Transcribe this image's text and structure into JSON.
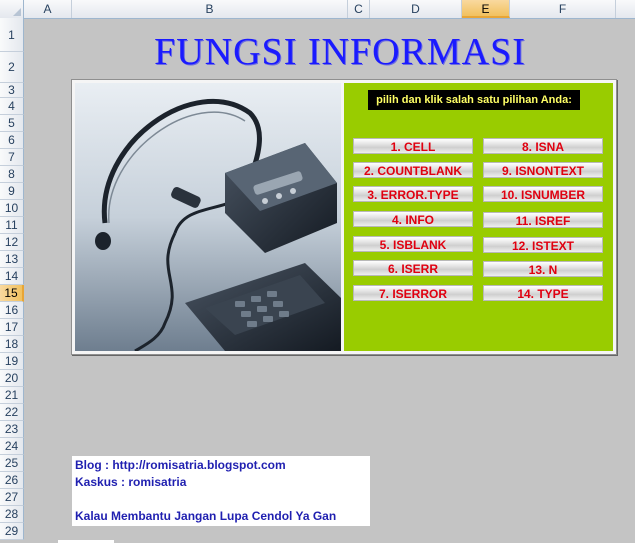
{
  "columns": [
    "A",
    "B",
    "C",
    "D",
    "E",
    "F"
  ],
  "selected_column": "E",
  "rows": [
    "1",
    "2",
    "3",
    "4",
    "5",
    "6",
    "7",
    "8",
    "9",
    "10",
    "11",
    "12",
    "13",
    "14",
    "15",
    "16",
    "17",
    "18",
    "19",
    "20",
    "21",
    "22",
    "23",
    "24",
    "25",
    "26",
    "27",
    "28",
    "29"
  ],
  "selected_row": "15",
  "title": "FUNGSI INFORMASI",
  "panel": {
    "hint": "pilih dan klik salah satu pilihan Anda:",
    "buttons_left": [
      "1. CELL",
      "2. COUNTBLANK",
      "3. ERROR.TYPE",
      "4. INFO",
      "5. ISBLANK",
      "6. ISERR",
      "7. ISERROR"
    ],
    "buttons_right": [
      "8. ISNA",
      "9. ISNONTEXT",
      "10. ISNUMBER",
      "11. ISREF",
      "12. ISTEXT",
      "13. N",
      "14. TYPE"
    ]
  },
  "info": {
    "blog": "Blog : http://romisatria.blogspot.com",
    "kaskus": "Kaskus : romisatria",
    "message": "Kalau Membantu Jangan Lupa Cendol Ya Gan"
  }
}
